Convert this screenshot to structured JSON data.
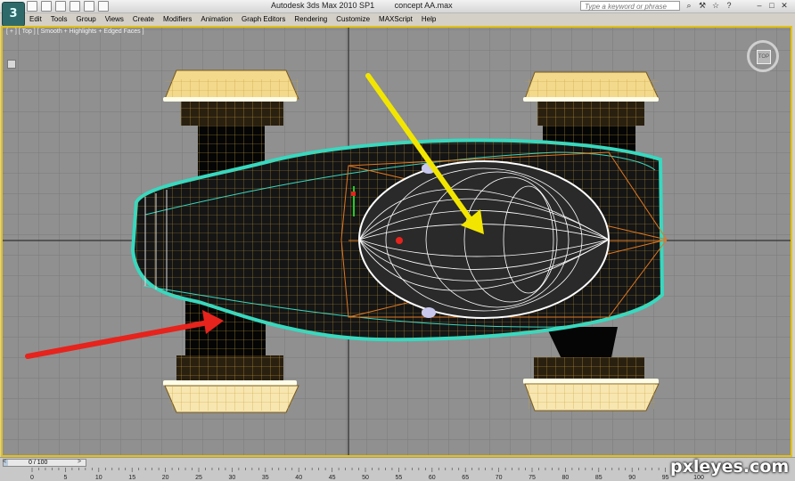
{
  "title": {
    "app": "Autodesk 3ds Max  2010 SP1",
    "file": "concept AA.max"
  },
  "app_logo_text": "3",
  "search": {
    "placeholder": "Type a keyword or phrase"
  },
  "menu": [
    "Edit",
    "Tools",
    "Group",
    "Views",
    "Create",
    "Modifiers",
    "Animation",
    "Graph Editors",
    "Rendering",
    "Customize",
    "MAXScript",
    "Help"
  ],
  "viewport": {
    "label": "[ + ] [ Top ] [ Smooth + Highlights + Edged Faces ]",
    "background_color": "#909090",
    "border_color": "#e5c20f",
    "viewcube_face": "TOP"
  },
  "timeline": {
    "frame_readout": "0 / 100",
    "left_arrow": "<",
    "right_arrow": ">",
    "ticks": [
      "0",
      "5",
      "10",
      "15",
      "20",
      "25",
      "30",
      "35",
      "40",
      "45",
      "50",
      "55",
      "60",
      "65",
      "70",
      "75",
      "80",
      "85",
      "90",
      "95",
      "100"
    ]
  },
  "annotations": {
    "yellow_arrow_color": "#f2e600",
    "red_arrow_color": "#e6231c"
  },
  "watermark": "pxleyes.com",
  "icons": [
    "app-logo",
    "new-file-icon",
    "open-folder-icon",
    "save-icon",
    "undo-icon",
    "redo-icon",
    "project-icon",
    "binoculars-icon",
    "star-icon",
    "help-icon",
    "minimize-icon",
    "maximize-icon",
    "close-icon"
  ]
}
